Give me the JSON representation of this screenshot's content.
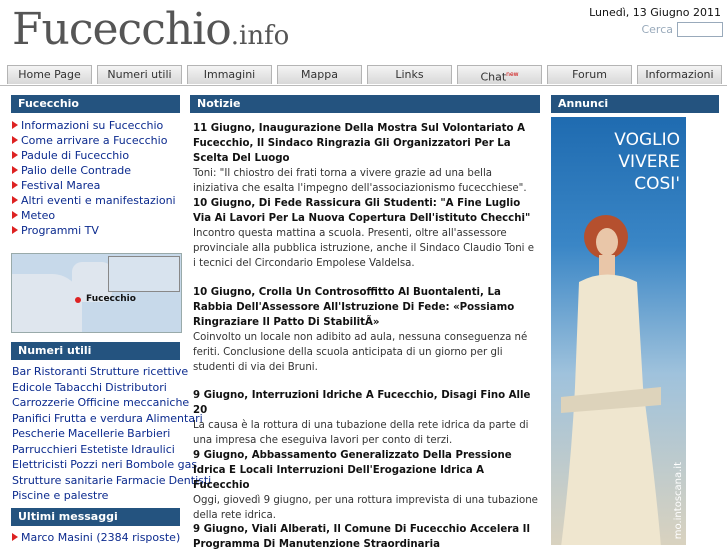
{
  "header": {
    "logo_main": "Fucecchio",
    "logo_sub": ".info",
    "date": "Lunedì, 13 Giugno 2011",
    "search_label": "Cerca",
    "search_value": ""
  },
  "nav": {
    "tabs": [
      {
        "label": "Home Page"
      },
      {
        "label": "Numeri utili"
      },
      {
        "label": "Immagini"
      },
      {
        "label": "Mappa"
      },
      {
        "label": "Links"
      },
      {
        "label": "Chat",
        "badge": "new"
      },
      {
        "label": "Forum"
      },
      {
        "label": "Informazioni"
      }
    ]
  },
  "sidebar": {
    "title": "Fucecchio",
    "items": [
      "Informazioni su Fucecchio",
      "Come arrivare a Fucecchio",
      "Padule di Fucecchio",
      "Palio delle Contrade",
      "Festival Marea",
      "Altri eventi e manifestazioni",
      "Meteo",
      "Programmi TV"
    ],
    "map_label": "Fucecchio",
    "utili_title": "Numeri utili",
    "utili_links": [
      "Bar",
      "Ristoranti",
      "Strutture ricettive",
      "Edicole",
      "Tabacchi",
      "Distributori",
      "Carrozzerie",
      "Officine meccaniche",
      "Panifici",
      "Frutta e verdura",
      "Alimentari",
      "Pescherie",
      "Macellerie",
      "Barbieri",
      "Parrucchieri",
      "Estetiste",
      "Idraulici",
      "Elettricisti",
      "Pozzi neri",
      "Bombole gas",
      "Strutture sanitarie",
      "Farmacie",
      "Dentisti",
      "Piscine e palestre"
    ],
    "messaggi_title": "Ultimi messaggi",
    "messaggi_first": "Marco Masini (2384 risposte)"
  },
  "news": {
    "title": "Notizie",
    "items": [
      {
        "title": "11 Giugno, Inaugurazione Della Mostra Sul Volontariato A Fucecchio, Il Sindaco Ringrazia Gli Organizzatori Per La Scelta Del Luogo",
        "summary": "Toni: \"Il chiostro dei frati torna a vivere grazie ad una bella iniziativa che esalta l'impegno dell'associazionismo fucecchiese\"."
      },
      {
        "title": "10 Giugno, Di Fede Rassicura Gli Studenti: \"A Fine Luglio Via Ai Lavori Per La Nuova Copertura Dell'istituto Checchi\"",
        "summary": "Incontro questa mattina a scuola. Presenti, oltre all'assessore provinciale alla pubblica istruzione, anche il Sindaco Claudio Toni e i tecnici del Circondario Empolese Valdelsa."
      },
      {
        "title": "10 Giugno, Crolla Un Controsoffitto Al Buontalenti, La Rabbia Dell'Assessore All'Istruzione Di Fede: «Possiamo Ringraziare Il Patto Di StabilitÃ»",
        "summary": "Coinvolto un locale non adibito ad aula, nessuna conseguenza né feriti. Conclusione della scuola anticipata di un giorno per gli studenti di via dei Bruni."
      },
      {
        "title": "9 Giugno, Interruzioni Idriche A Fucecchio, Disagi Fino Alle 20",
        "summary": "La causa è la rottura di una tubazione della rete idrica da parte di una impresa che eseguiva lavori per conto di terzi."
      },
      {
        "title": "9 Giugno, Abbassamento Generalizzato Della Pressione Idrica E Locali Interruzioni Dell'Erogazione Idrica A Fucecchio",
        "summary": "Oggi, giovedì 9 giugno, per una rottura imprevista di una tubazione della rete idrica."
      },
      {
        "title": "9 Giugno, Viali Alberati, Il Comune Di Fucecchio Accelera Il Programma Di Manutenzione Straordinaria",
        "summary": ""
      }
    ]
  },
  "ads": {
    "title": "Annunci",
    "text_line1": "VOGLIO",
    "text_line2": "VIVERE",
    "text_line3": "COSI'",
    "side_text": "mo.intoscana.it"
  },
  "colors": {
    "panel_header": "#24537f",
    "link": "#0b2a8e",
    "bullet": "#dd2222"
  }
}
